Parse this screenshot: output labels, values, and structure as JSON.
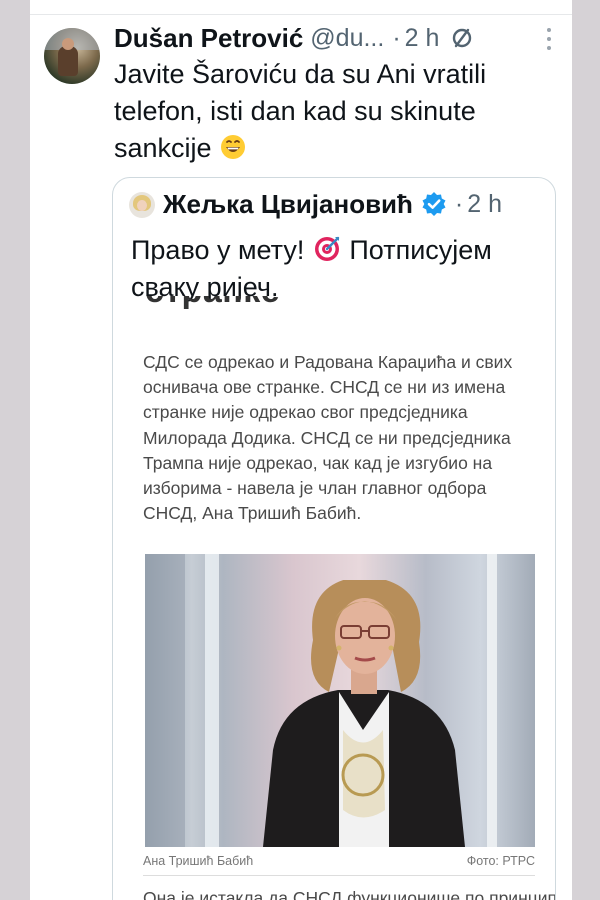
{
  "tweet": {
    "author_name": "Dušan Petrović",
    "handle": "@du...",
    "separator": "·",
    "time": "2 h",
    "text": "Javite Šaroviću da su Ani vratili telefon, isti dan kad su skinute sankcije",
    "emoji_icon": "grinning-face-icon",
    "translate_icon": "no-translate-icon",
    "more_icon": "more-vertical-icon"
  },
  "quote": {
    "author_name": "Жељка Цвијановић",
    "verified_icon": "verified-badge-icon",
    "verified_color": "#1d9bf0",
    "separator": "·",
    "time": "2 h",
    "text_before": "Право у мету!",
    "text_after": "Потписујем сваку ријеч.",
    "emoji_icon": "direct-hit-target-icon"
  },
  "article": {
    "heading_fragment": "странке",
    "paragraph": "СДС се одрекао и Радована Караџића и свих оснивача ове странке. СНСД се ни из имена странке није одрекао свог предсједника Милорада Додика. СНСД се ни предсједника Трампа није одрекао, чак кад је изгубио на изборима - навела је члан главног одбора СНСД, Ана Тришић Бабић.",
    "photo_caption": "Ана Тришић Бабић",
    "photo_credit": "Фото: РТРС",
    "next_paragraph_fragment": "Она је истакла да СНСД функционише по принципу"
  }
}
